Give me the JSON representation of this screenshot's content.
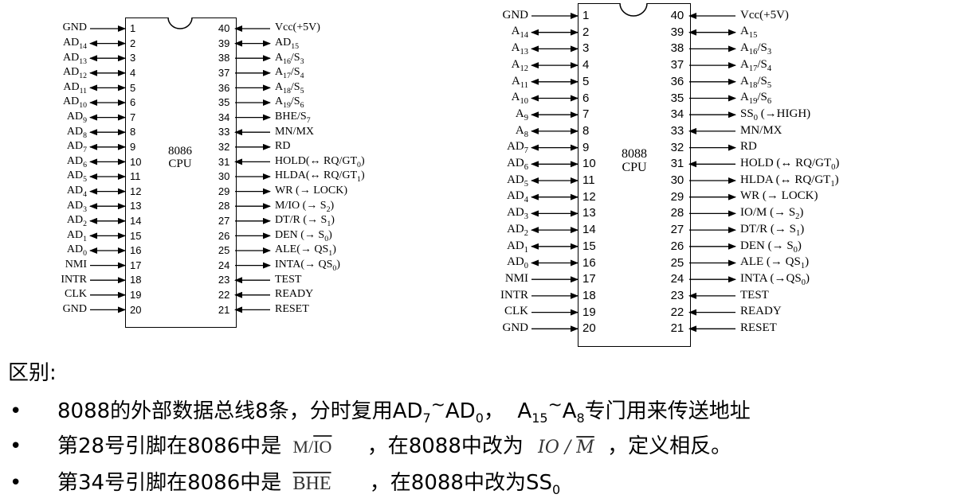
{
  "chip8086": {
    "cpu_label": [
      "8086",
      "CPU"
    ],
    "left": [
      {
        "n": "1",
        "label": "GND",
        "dir": "in"
      },
      {
        "n": "2",
        "label": "AD14",
        "dir": "bi"
      },
      {
        "n": "3",
        "label": "AD13",
        "dir": "bi"
      },
      {
        "n": "4",
        "label": "AD12",
        "dir": "bi"
      },
      {
        "n": "5",
        "label": "AD11",
        "dir": "bi"
      },
      {
        "n": "6",
        "label": "AD10",
        "dir": "bi"
      },
      {
        "n": "7",
        "label": "AD9",
        "dir": "bi"
      },
      {
        "n": "8",
        "label": "AD8",
        "dir": "bi"
      },
      {
        "n": "9",
        "label": "AD7",
        "dir": "bi"
      },
      {
        "n": "10",
        "label": "AD6",
        "dir": "bi"
      },
      {
        "n": "11",
        "label": "AD5",
        "dir": "bi"
      },
      {
        "n": "12",
        "label": "AD4",
        "dir": "bi"
      },
      {
        "n": "13",
        "label": "AD3",
        "dir": "bi"
      },
      {
        "n": "14",
        "label": "AD2",
        "dir": "bi"
      },
      {
        "n": "15",
        "label": "AD1",
        "dir": "bi"
      },
      {
        "n": "16",
        "label": "AD0",
        "dir": "bi"
      },
      {
        "n": "17",
        "label": "NMI",
        "dir": "in"
      },
      {
        "n": "18",
        "label": "INTR",
        "dir": "in"
      },
      {
        "n": "19",
        "label": "CLK",
        "dir": "in"
      },
      {
        "n": "20",
        "label": "GND",
        "dir": "in"
      }
    ],
    "right": [
      {
        "n": "40",
        "label": "Vcc(+5V)",
        "dir": "in"
      },
      {
        "n": "39",
        "label": "AD15",
        "dir": "bi"
      },
      {
        "n": "38",
        "label": "A16/S3",
        "dir": "out"
      },
      {
        "n": "37",
        "label": "A17/S4",
        "dir": "out"
      },
      {
        "n": "36",
        "label": "A18/S5",
        "dir": "out"
      },
      {
        "n": "35",
        "label": "A19/S6",
        "dir": "out"
      },
      {
        "n": "34",
        "label": "BHE/S7",
        "dir": "out"
      },
      {
        "n": "33",
        "label": "MN/MX",
        "dir": "in"
      },
      {
        "n": "32",
        "label": "RD",
        "dir": "out"
      },
      {
        "n": "31",
        "label": "HOLD(↔ RQ/GT0)",
        "dir": "in"
      },
      {
        "n": "30",
        "label": "HLDA(↔ RQ/GT1)",
        "dir": "out"
      },
      {
        "n": "29",
        "label": "WR (→ LOCK)",
        "dir": "out"
      },
      {
        "n": "28",
        "label": "M/IO (→ S2)",
        "dir": "out"
      },
      {
        "n": "27",
        "label": "DT/R (→ S1)",
        "dir": "out"
      },
      {
        "n": "26",
        "label": "DEN (→ S0)",
        "dir": "out"
      },
      {
        "n": "25",
        "label": "ALE(→ QS1)",
        "dir": "out"
      },
      {
        "n": "24",
        "label": "INTA(→ QS0)",
        "dir": "out"
      },
      {
        "n": "23",
        "label": "TEST",
        "dir": "in"
      },
      {
        "n": "22",
        "label": "READY",
        "dir": "in"
      },
      {
        "n": "21",
        "label": "RESET",
        "dir": "in"
      }
    ]
  },
  "chip8088": {
    "cpu_label": [
      "8088",
      "CPU"
    ],
    "left": [
      {
        "n": "1",
        "label": "GND",
        "dir": "in"
      },
      {
        "n": "2",
        "label": "A14",
        "dir": "bi"
      },
      {
        "n": "3",
        "label": "A13",
        "dir": "bi"
      },
      {
        "n": "4",
        "label": "A12",
        "dir": "bi"
      },
      {
        "n": "5",
        "label": "A11",
        "dir": "bi"
      },
      {
        "n": "6",
        "label": "A10",
        "dir": "bi"
      },
      {
        "n": "7",
        "label": "A9",
        "dir": "bi"
      },
      {
        "n": "8",
        "label": "A8",
        "dir": "bi"
      },
      {
        "n": "9",
        "label": "AD7",
        "dir": "bi"
      },
      {
        "n": "10",
        "label": "AD6",
        "dir": "bi"
      },
      {
        "n": "11",
        "label": "AD5",
        "dir": "bi"
      },
      {
        "n": "12",
        "label": "AD4",
        "dir": "bi"
      },
      {
        "n": "13",
        "label": "AD3",
        "dir": "bi"
      },
      {
        "n": "14",
        "label": "AD2",
        "dir": "bi"
      },
      {
        "n": "15",
        "label": "AD1",
        "dir": "bi"
      },
      {
        "n": "16",
        "label": "AD0",
        "dir": "bi"
      },
      {
        "n": "17",
        "label": "NMI",
        "dir": "in"
      },
      {
        "n": "18",
        "label": "INTR",
        "dir": "in"
      },
      {
        "n": "19",
        "label": "CLK",
        "dir": "in"
      },
      {
        "n": "20",
        "label": "GND",
        "dir": "in"
      }
    ],
    "right": [
      {
        "n": "40",
        "label": "Vcc(+5V)",
        "dir": "in"
      },
      {
        "n": "39",
        "label": "A15",
        "dir": "bi"
      },
      {
        "n": "38",
        "label": "A16/S3",
        "dir": "out"
      },
      {
        "n": "37",
        "label": "A17/S4",
        "dir": "out"
      },
      {
        "n": "36",
        "label": "A18/S5",
        "dir": "out"
      },
      {
        "n": "35",
        "label": "A19/S6",
        "dir": "out"
      },
      {
        "n": "34",
        "label": "SS0 (→HIGH)",
        "dir": "out"
      },
      {
        "n": "33",
        "label": "MN/MX",
        "dir": "in"
      },
      {
        "n": "32",
        "label": "RD",
        "dir": "out"
      },
      {
        "n": "31",
        "label": "HOLD (↔ RQ/GT0)",
        "dir": "in"
      },
      {
        "n": "30",
        "label": "HLDA (↔ RQ/GT1)",
        "dir": "out"
      },
      {
        "n": "29",
        "label": "WR (→ LOCK)",
        "dir": "out"
      },
      {
        "n": "28",
        "label": "IO/M (→ S2)",
        "dir": "out"
      },
      {
        "n": "27",
        "label": "DT/R (→ S1)",
        "dir": "out"
      },
      {
        "n": "26",
        "label": "DEN (→ S0)",
        "dir": "out"
      },
      {
        "n": "25",
        "label": "ALE (→ QS1)",
        "dir": "out"
      },
      {
        "n": "24",
        "label": "INTA (→QS0)",
        "dir": "out"
      },
      {
        "n": "23",
        "label": "TEST",
        "dir": "in"
      },
      {
        "n": "22",
        "label": "READY",
        "dir": "in"
      },
      {
        "n": "21",
        "label": "RESET",
        "dir": "in"
      }
    ]
  },
  "differences": {
    "title": "区别:",
    "bullet_char": "•",
    "bullet1": {
      "text1": "8088的外部数据总线8条，分时复用",
      "ad_high": "AD",
      "ad_high_sub": "7",
      "tilde": "~",
      "ad_low": "AD",
      "ad_low_sub": "0",
      "sep": "，  ",
      "a_high": "A",
      "a_high_sub": "15",
      "tilde2": "~",
      "a_low": "A",
      "a_low_sub": "8",
      "text2": "专门用来传送地址"
    },
    "bullet2": {
      "text1": "第28号引脚在8086中是",
      "pin_8086_m": "M/",
      "pin_8086_io": "IO",
      "text2": "，在8088中改为",
      "pin_8088_io": "IO",
      "pin_8088_slash": " / ",
      "pin_8088_m": "M",
      "text3": "，定义相反。"
    },
    "bullet3": {
      "text1": "第34号引脚在8086中是",
      "pin_8086": "BHE",
      "text2": "，在8088中改为",
      "ss": "SS",
      "ss_sub": "0"
    }
  }
}
